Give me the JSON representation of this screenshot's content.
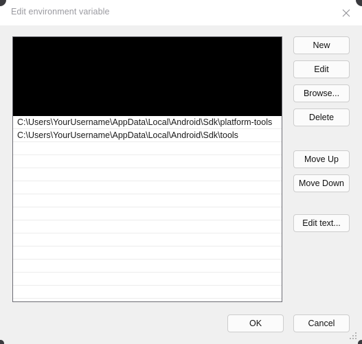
{
  "window": {
    "title": "Edit environment variable",
    "close_icon": "close-icon",
    "background_color": "#f0f0f0",
    "titlebar_color": "#ffffff",
    "title_text_color": "#9a9aa0"
  },
  "list": {
    "redacted_block_present": true,
    "border_color": "#6b6b72",
    "row_separator_color": "#ececec",
    "entries": [
      "C:\\Users\\YourUsername\\AppData\\Local\\Android\\Sdk\\platform-tools",
      "C:\\Users\\YourUsername\\AppData\\Local\\Android\\Sdk\\tools"
    ],
    "empty_row_count": 14
  },
  "side_buttons": {
    "new": "New",
    "edit": "Edit",
    "browse": "Browse...",
    "delete": "Delete",
    "move_up": "Move Up",
    "move_down": "Move Down",
    "edit_text": "Edit text..."
  },
  "footer": {
    "ok": "OK",
    "cancel": "Cancel",
    "resize_grip_icon": "resize-grip-icon"
  }
}
